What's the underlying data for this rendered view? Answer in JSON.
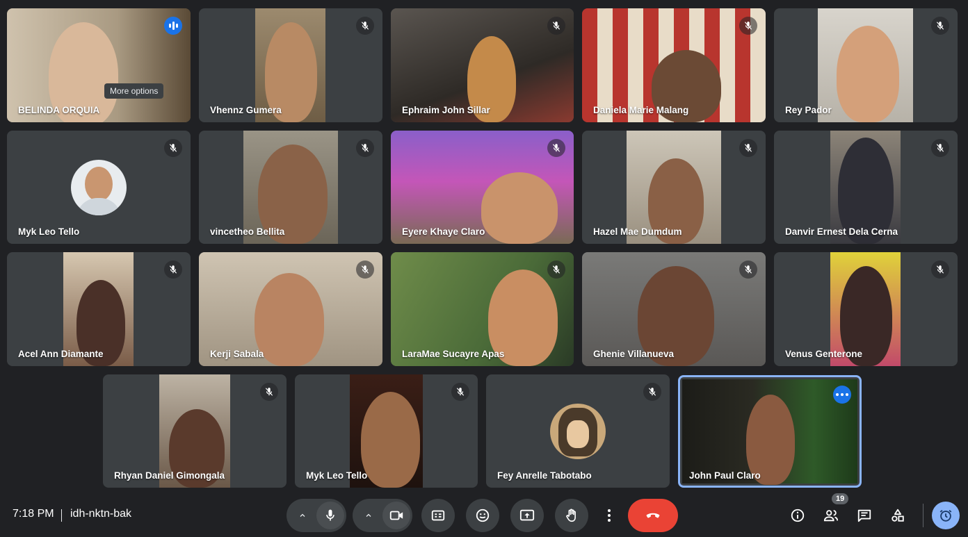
{
  "participants": [
    {
      "name": "BELINDA ORQUIA",
      "state": "speaking"
    },
    {
      "name": "Vhennz Gumera",
      "state": "muted"
    },
    {
      "name": "Ephraim John Sillar",
      "state": "muted"
    },
    {
      "name": "Daniela Marie Malang",
      "state": "muted"
    },
    {
      "name": "Rey Pador",
      "state": "muted"
    },
    {
      "name": "Myk Leo Tello",
      "state": "muted"
    },
    {
      "name": "vincetheo Bellita",
      "state": "muted"
    },
    {
      "name": "Eyere Khaye Claro",
      "state": "muted"
    },
    {
      "name": "Hazel Mae Dumdum",
      "state": "muted"
    },
    {
      "name": "Danvir Ernest Dela Cerna",
      "state": "muted"
    },
    {
      "name": "Acel Ann Diamante",
      "state": "muted"
    },
    {
      "name": "Kerji Sabala",
      "state": "muted"
    },
    {
      "name": "LaraMae Sucayre Apas",
      "state": "muted"
    },
    {
      "name": "Ghenie Villanueva",
      "state": "muted"
    },
    {
      "name": "Venus Genterone",
      "state": "muted"
    },
    {
      "name": "Rhyan Daniel Gimongala",
      "state": "muted"
    },
    {
      "name": "Myk Leo Tello",
      "state": "muted"
    },
    {
      "name": "Fey Anrelle Tabotabo",
      "state": "muted"
    },
    {
      "name": "John Paul Claro",
      "state": "self"
    }
  ],
  "tooltip": "More options",
  "bottom_bar": {
    "time": "7:18 PM",
    "meeting_code": "idh-nktn-bak",
    "people_count": "19"
  },
  "colors": {
    "background": "#202124",
    "tile": "#3c4043",
    "end_call": "#ea4335",
    "accent": "#1a73e8",
    "self_border": "#8ab4f8"
  },
  "icons": [
    "mic-icon",
    "camera-icon",
    "captions-icon",
    "emoji-icon",
    "present-icon",
    "hand-icon",
    "more-vert-icon",
    "end-call-icon",
    "info-icon",
    "people-icon",
    "chat-icon",
    "activities-icon",
    "timer-icon"
  ]
}
